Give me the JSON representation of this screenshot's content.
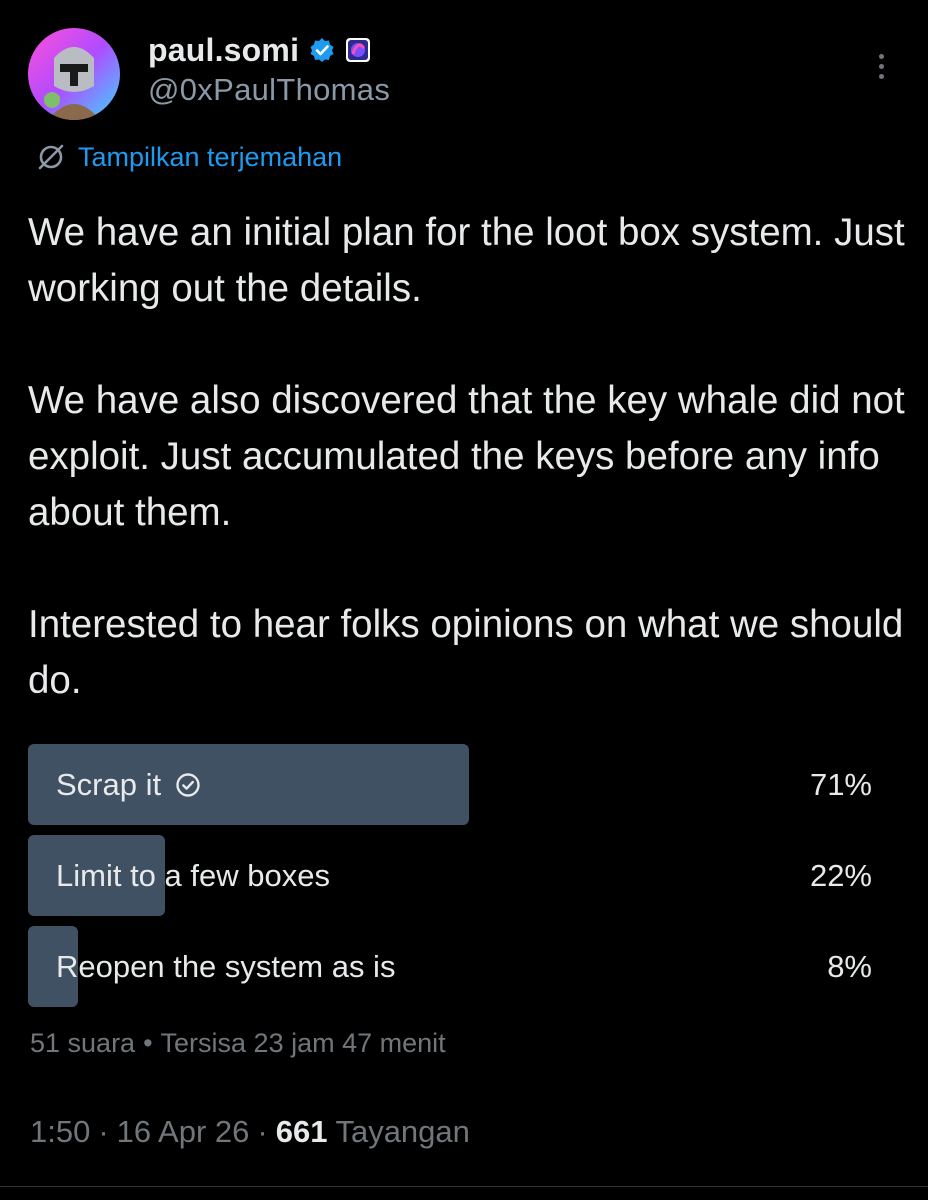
{
  "author": {
    "display_name": "paul.somi",
    "handle": "@0xPaulThomas",
    "verified_icon": "verified-badge-icon",
    "affiliate_icon": "affiliate-badge-icon"
  },
  "translate": {
    "label": "Tampilkan terjemahan",
    "icon": "globe-slash-icon"
  },
  "tweet": {
    "paragraphs": [
      "We have an initial plan for the loot box system. Just working out the details.",
      "We have also discovered that the key whale did not exploit. Just accumulated the keys before any info about them.",
      "Interested to hear folks opinions on what we should do."
    ]
  },
  "poll": {
    "options": [
      {
        "label": "Scrap it",
        "percent_label": "71%",
        "percent": 71,
        "winner": true
      },
      {
        "label": "Limit to a few boxes",
        "percent_label": "22%",
        "percent": 22,
        "winner": false
      },
      {
        "label": "Reopen the system as is",
        "percent_label": "8%",
        "percent": 8,
        "winner": false
      }
    ],
    "votes": "51 suara",
    "separator": "•",
    "time_left": "Tersisa 23 jam 47 menit"
  },
  "footer": {
    "time": "1:50",
    "sep1": "·",
    "date": "16 Apr 26",
    "sep2": "·",
    "views_count": "661",
    "views_label": "Tayangan"
  },
  "colors": {
    "background": "#000000",
    "text": "#e7e9ea",
    "muted": "#71767b",
    "link": "#1d9bf0",
    "poll_bar": "#3f5163",
    "verified": "#1d9bf0"
  }
}
